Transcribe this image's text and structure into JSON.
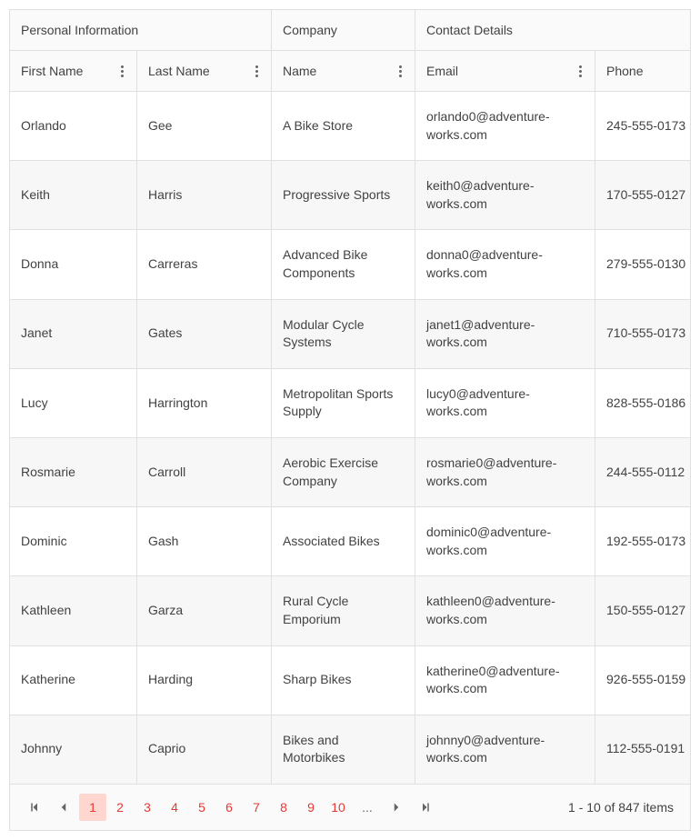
{
  "groupHeaders": {
    "personal": "Personal Information",
    "company": "Company",
    "contact": "Contact Details"
  },
  "columns": {
    "firstName": "First Name",
    "lastName": "Last Name",
    "companyName": "Name",
    "email": "Email",
    "phone": "Phone"
  },
  "rows": [
    {
      "firstName": "Orlando",
      "lastName": "Gee",
      "company": "A Bike Store",
      "email": "orlando0@adventure-works.com",
      "phone": "245-555-0173"
    },
    {
      "firstName": "Keith",
      "lastName": "Harris",
      "company": "Progressive Sports",
      "email": "keith0@adventure-works.com",
      "phone": "170-555-0127"
    },
    {
      "firstName": "Donna",
      "lastName": "Carreras",
      "company": "Advanced Bike Components",
      "email": "donna0@adventure-works.com",
      "phone": "279-555-0130"
    },
    {
      "firstName": "Janet",
      "lastName": "Gates",
      "company": "Modular Cycle Systems",
      "email": "janet1@adventure-works.com",
      "phone": "710-555-0173"
    },
    {
      "firstName": "Lucy",
      "lastName": "Harrington",
      "company": "Metropolitan Sports Supply",
      "email": "lucy0@adventure-works.com",
      "phone": "828-555-0186"
    },
    {
      "firstName": "Rosmarie",
      "lastName": "Carroll",
      "company": "Aerobic Exercise Company",
      "email": "rosmarie0@adventure-works.com",
      "phone": "244-555-0112"
    },
    {
      "firstName": "Dominic",
      "lastName": "Gash",
      "company": "Associated Bikes",
      "email": "dominic0@adventure-works.com",
      "phone": "192-555-0173"
    },
    {
      "firstName": "Kathleen",
      "lastName": "Garza",
      "company": "Rural Cycle Emporium",
      "email": "kathleen0@adventure-works.com",
      "phone": "150-555-0127"
    },
    {
      "firstName": "Katherine",
      "lastName": "Harding",
      "company": "Sharp Bikes",
      "email": "katherine0@adventure-works.com",
      "phone": "926-555-0159"
    },
    {
      "firstName": "Johnny",
      "lastName": "Caprio",
      "company": "Bikes and Motorbikes",
      "email": "johnny0@adventure-works.com",
      "phone": "112-555-0191"
    }
  ],
  "pager": {
    "pages": [
      "1",
      "2",
      "3",
      "4",
      "5",
      "6",
      "7",
      "8",
      "9",
      "10"
    ],
    "ellipsis": "...",
    "currentPage": "1",
    "info": "1 - 10 of 847 items"
  }
}
